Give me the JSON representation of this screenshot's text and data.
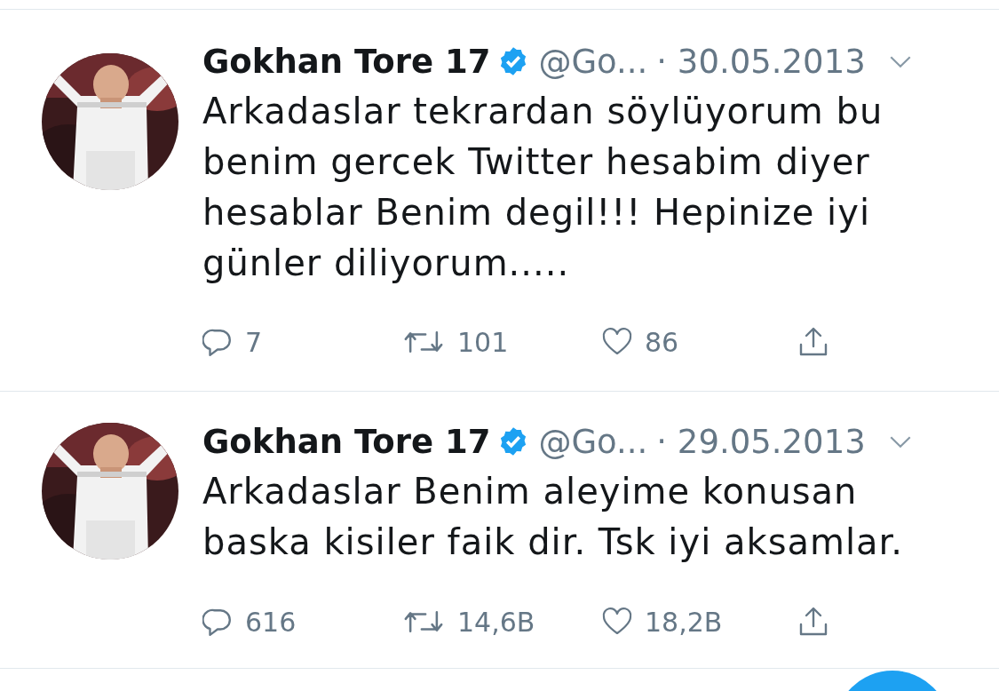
{
  "tweets": [
    {
      "name": "Gokhan Tore 17",
      "verified": true,
      "handle": "@Go...",
      "date": "· 30.05.2013",
      "text": "Arkadaslar tekrardan söylüyorum bu benim gercek Twitter hesabim diyer hesablar Benim degil!!! Hepinize iyi günler diliyorum.....",
      "replies": "7",
      "retweets": "101",
      "likes": "86"
    },
    {
      "name": "Gokhan Tore 17",
      "verified": true,
      "handle": "@Go...",
      "date": "· 29.05.2013",
      "text": "Arkadaslar Benim aleyime konusan baska kisiler faik dir. Tsk iyi aksamlar.",
      "replies": "616",
      "retweets": "14,6B",
      "likes": "18,2B"
    }
  ]
}
